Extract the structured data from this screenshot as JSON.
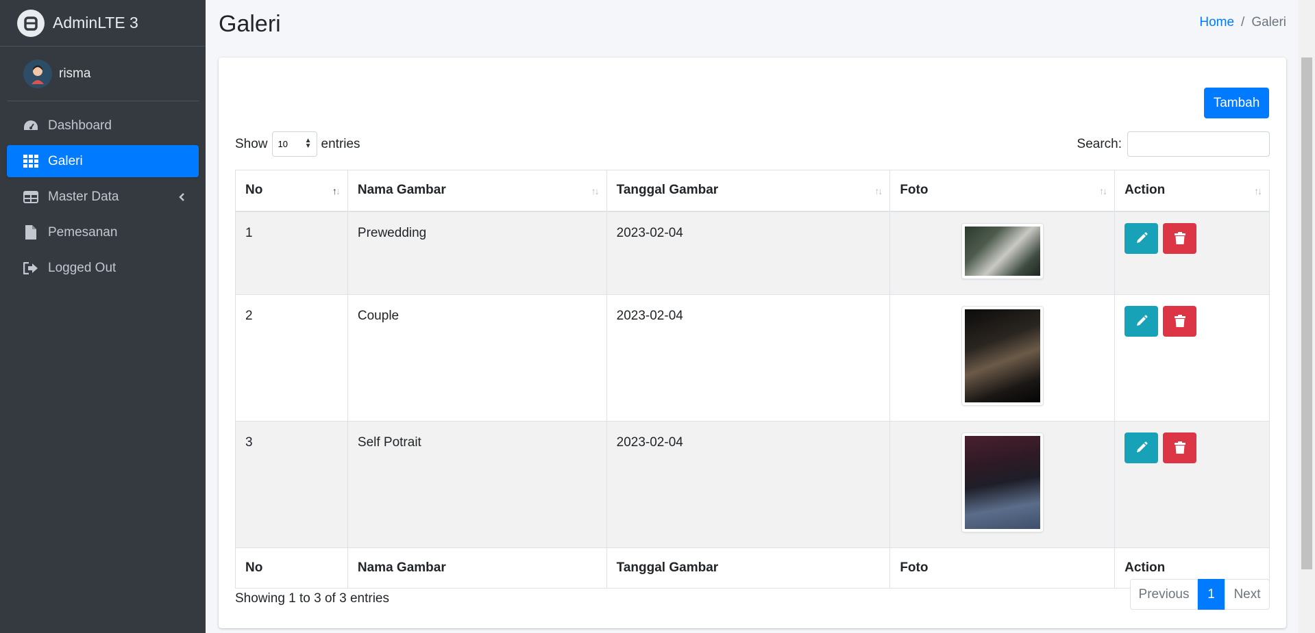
{
  "brand": {
    "name": "AdminLTE 3"
  },
  "user": {
    "name": "risma"
  },
  "sidebar": {
    "items": [
      {
        "label": "Dashboard",
        "icon": "dashboard-icon",
        "active": false
      },
      {
        "label": "Galeri",
        "icon": "grid-icon",
        "active": true
      },
      {
        "label": "Master Data",
        "icon": "table-icon",
        "active": false
      },
      {
        "label": "Pemesanan",
        "icon": "file-icon",
        "active": false
      },
      {
        "label": "Logged Out",
        "icon": "logout-icon",
        "active": false
      }
    ]
  },
  "page": {
    "title": "Galeri"
  },
  "breadcrumb": {
    "home": "Home",
    "separator": "/",
    "current": "Galeri"
  },
  "toolbar": {
    "add_label": "Tambah"
  },
  "length": {
    "show": "Show",
    "value": "10",
    "entries": "entries"
  },
  "search": {
    "label": "Search:",
    "value": ""
  },
  "table": {
    "headers": [
      "No",
      "Nama Gambar",
      "Tanggal Gambar",
      "Foto",
      "Action"
    ],
    "rows": [
      {
        "no": "1",
        "name": "Prewedding",
        "date": "2023-02-04",
        "photo": "prewedding-photo"
      },
      {
        "no": "2",
        "name": "Couple",
        "date": "2023-02-04",
        "photo": "couple-photo"
      },
      {
        "no": "3",
        "name": "Self Potrait",
        "date": "2023-02-04",
        "photo": "portrait-photo"
      }
    ],
    "footers": [
      "No",
      "Nama Gambar",
      "Tanggal Gambar",
      "Foto",
      "Action"
    ]
  },
  "info": "Showing 1 to 3 of 3 entries",
  "pagination": {
    "previous": "Previous",
    "current": "1",
    "next": "Next"
  },
  "colors": {
    "primary": "#007bff",
    "sidebar": "#343a40",
    "info": "#17a2b8",
    "danger": "#dc3545"
  }
}
